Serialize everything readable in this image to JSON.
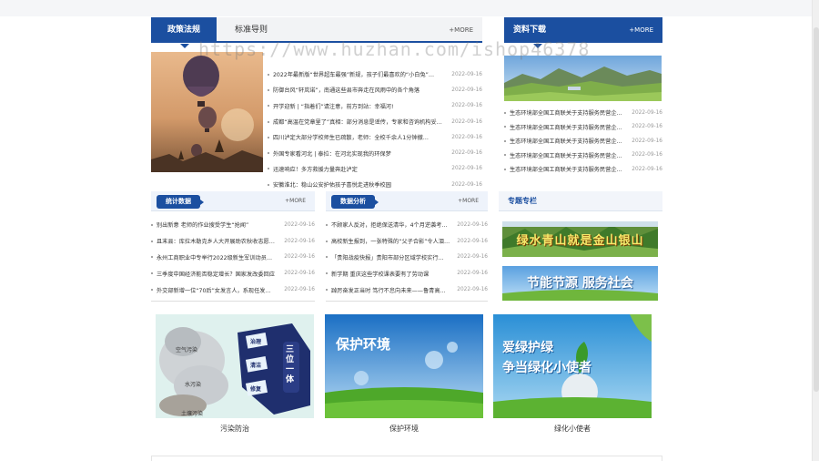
{
  "policy": {
    "tab_active": "政策法规",
    "tab_inactive": "标准导则",
    "more": "+MORE",
    "items": [
      {
        "title": "2022年最新版“世界超车最强”新规，孩子们最喜欢的“小白兔”…",
        "date": "2022-09-16"
      },
      {
        "title": "防御台风“轩岚诺”，南通这些县市奔走在风雨中的各个角落",
        "date": "2022-09-16"
      },
      {
        "title": "开学迎新 | “指着们”请注意，前方到站：幸福河!",
        "date": "2022-09-16"
      },
      {
        "title": "成都“高温在党章里了”真相：部分消息是谣传，专家和咨询机构妥…",
        "date": "2022-09-16"
      },
      {
        "title": "四川泸定大部分学校师生已疏散，老师：全校千余人1分钟撤…",
        "date": "2022-09-16"
      },
      {
        "title": "外国专家看河北 | 泰拉：在河北实现我的环保梦",
        "date": "2022-09-16"
      },
      {
        "title": "迅速响应！多方救援力量奔赴泸定",
        "date": "2022-09-16"
      },
      {
        "title": "安徽淮北：稳山公安护佑孩子喜悦走进秋季校园",
        "date": "2022-09-16"
      }
    ]
  },
  "downloads": {
    "title": "资料下载",
    "more": "+MORE",
    "items": [
      {
        "title": "生态环境部全国工商联关于支持服务民营企…",
        "date": "2022-09-16"
      },
      {
        "title": "生态环境部全国工商联关于支持服务民营企…",
        "date": "2022-09-16"
      },
      {
        "title": "生态环境部全国工商联关于支持服务民营企…",
        "date": "2022-09-16"
      },
      {
        "title": "生态环境部全国工商联关于支持服务民营企…",
        "date": "2022-09-16"
      },
      {
        "title": "生态环境部全国工商联关于支持服务民营企…",
        "date": "2022-09-16"
      }
    ]
  },
  "stats": {
    "title": "统计数据",
    "more": "+MORE",
    "items": [
      {
        "title": "别出新意 老师的作业搜受学生“抢闻”",
        "date": "2022-09-16"
      },
      {
        "title": "且末县：库拉木勒克乡人大开展助农秋收志愿…",
        "date": "2022-09-16"
      },
      {
        "title": "永州工商职业中专举行2022级新生军训动员…",
        "date": "2022-09-16"
      },
      {
        "title": "三季度中国经济能否稳定增长？国家发改委回应",
        "date": "2022-09-16"
      },
      {
        "title": "外交部新增一位“70后”女发言人，系现任发…",
        "date": "2022-09-16"
      }
    ]
  },
  "analysis": {
    "title": "数据分析",
    "more": "+MORE",
    "items": [
      {
        "title": "不顾家人反对，拒绝保送清华，4个月逆袭考…",
        "date": "2022-09-16"
      },
      {
        "title": "高校新生报到，一张特殊的“父子合影”令人泪…",
        "date": "2022-09-16"
      },
      {
        "title": "「贵阳战疫快报」贵阳市部分区域学校实行…",
        "date": "2022-09-16"
      },
      {
        "title": "新学期 重庆这些学校课表要有了劳动课",
        "date": "2022-09-16"
      },
      {
        "title": "踔厉奋发正当时 笃行不怠向未来——鲁青高…",
        "date": "2022-09-16"
      }
    ]
  },
  "special": {
    "title": "专题专栏",
    "banner1_text": "绿水青山就是金山银山",
    "banner2_text": "节能节源 服务社会"
  },
  "cards": [
    {
      "caption": "污染防治",
      "labels": {
        "air": "空气污染",
        "water": "水污染",
        "soil": "土壤污染",
        "govern": "治理",
        "clean": "清洁",
        "repair": "修复",
        "unity": "三位一体"
      }
    },
    {
      "caption": "保护环境",
      "headline": "保护环境"
    },
    {
      "caption": "绿化小使者",
      "headline1": "爱绿护绿",
      "headline2": "争当绿化小使者"
    }
  ],
  "watermark": "https://www.huzhan.com/ishop46378",
  "colors": {
    "brand": "#1b4fa0",
    "date": "#999999"
  }
}
